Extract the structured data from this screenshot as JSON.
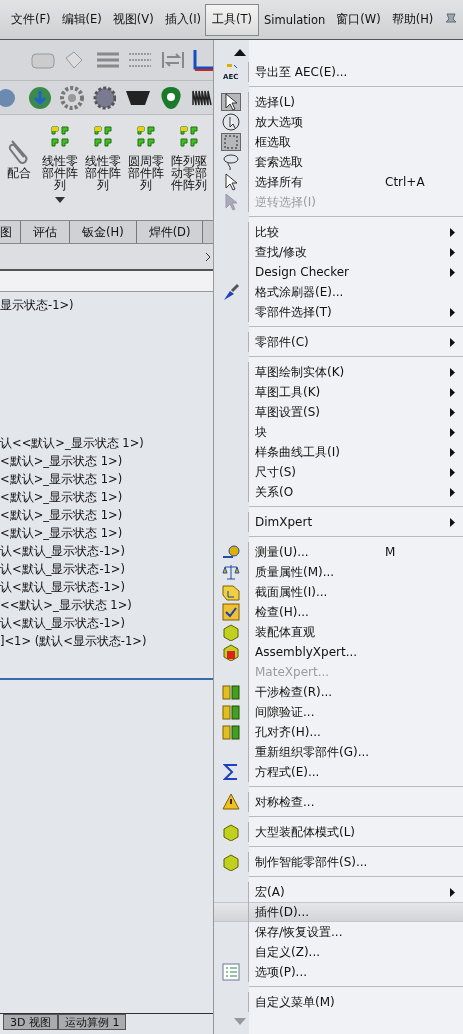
{
  "menu_bar": [
    {
      "label": "文件(F)",
      "selected": false
    },
    {
      "label": "编辑(E)",
      "selected": false
    },
    {
      "label": "视图(V)",
      "selected": false
    },
    {
      "label": "插入(I)",
      "selected": false
    },
    {
      "label": "工具(T)",
      "selected": true
    },
    {
      "label": "Simulation",
      "selected": false
    },
    {
      "label": "窗口(W)",
      "selected": false
    },
    {
      "label": "帮助(H)",
      "selected": false
    }
  ],
  "command_manager": [
    {
      "label": "配合",
      "dropdown": false
    },
    {
      "label": "线性零部件阵列",
      "dropdown": true
    },
    {
      "label": "线性零部件阵列",
      "dropdown": false
    },
    {
      "label": "圆周零部件阵列",
      "dropdown": false
    },
    {
      "label": "阵列驱动零部件阵列",
      "dropdown": false
    }
  ],
  "tabs": [
    {
      "label": "图"
    },
    {
      "label": "评估"
    },
    {
      "label": "钣金(H)"
    },
    {
      "label": "焊件(D)"
    }
  ],
  "tree": {
    "top_line": "显示状态-1>)",
    "lines": [
      "认<<默认>_显示状态 1>)",
      "<默认>_显示状态 1>)",
      "<默认>_显示状态 1>)",
      "<默认>_显示状态 1>)",
      "<默认>_显示状态 1>)",
      "<默认>_显示状态 1>)",
      "认<默认_显示状态-1>)",
      "认<默认_显示状态-1>)",
      "认<默认_显示状态-1>)",
      "<<默认>_显示状态 1>)",
      "认<默认_显示状态-1>)",
      "]<1> (默认<显示状态-1>)"
    ]
  },
  "bottom_tabs": [
    {
      "label": "3D 视图"
    },
    {
      "label": "运动算例 1"
    }
  ],
  "tools_menu": [
    {
      "kind": "item",
      "label": "导出至 AEC(E)...",
      "icon_label": "AEC",
      "submenu": false,
      "disabled": false,
      "highlighted": false,
      "pressed": false
    },
    {
      "kind": "separator"
    },
    {
      "kind": "item",
      "label": "选择(L)",
      "submenu": false,
      "disabled": false,
      "highlighted": false,
      "pressed": true
    },
    {
      "kind": "item",
      "label": "放大选项",
      "submenu": false,
      "disabled": false,
      "highlighted": false,
      "pressed": false
    },
    {
      "kind": "item",
      "label": "框选取",
      "submenu": false,
      "disabled": false,
      "highlighted": false,
      "pressed": true
    },
    {
      "kind": "item",
      "label": "套索选取",
      "submenu": false,
      "disabled": false,
      "highlighted": false,
      "pressed": false
    },
    {
      "kind": "item",
      "label": "选择所有",
      "shortcut": "Ctrl+A",
      "submenu": false,
      "disabled": false,
      "highlighted": false,
      "pressed": false
    },
    {
      "kind": "item",
      "label": "逆转选择(I)",
      "submenu": false,
      "disabled": true,
      "highlighted": false,
      "pressed": false
    },
    {
      "kind": "separator"
    },
    {
      "kind": "item",
      "label": "比较",
      "submenu": true,
      "disabled": false,
      "highlighted": false,
      "pressed": false
    },
    {
      "kind": "item",
      "label": "查找/修改",
      "submenu": true,
      "disabled": false,
      "highlighted": false,
      "pressed": false
    },
    {
      "kind": "item",
      "label": "Design Checker",
      "submenu": true,
      "disabled": false,
      "highlighted": false,
      "pressed": false
    },
    {
      "kind": "item",
      "label": "格式涂刷器(E)...",
      "submenu": false,
      "disabled": false,
      "highlighted": false,
      "pressed": false
    },
    {
      "kind": "item",
      "label": "零部件选择(T)",
      "submenu": true,
      "disabled": false,
      "highlighted": false,
      "pressed": false
    },
    {
      "kind": "separator"
    },
    {
      "kind": "item",
      "label": "零部件(C)",
      "submenu": true,
      "disabled": false,
      "highlighted": false,
      "pressed": false
    },
    {
      "kind": "separator"
    },
    {
      "kind": "item",
      "label": "草图绘制实体(K)",
      "submenu": true,
      "disabled": false,
      "highlighted": false,
      "pressed": false
    },
    {
      "kind": "item",
      "label": "草图工具(K)",
      "submenu": true,
      "disabled": false,
      "highlighted": false,
      "pressed": false
    },
    {
      "kind": "item",
      "label": "草图设置(S)",
      "submenu": true,
      "disabled": false,
      "highlighted": false,
      "pressed": false
    },
    {
      "kind": "item",
      "label": "块",
      "submenu": true,
      "disabled": false,
      "highlighted": false,
      "pressed": false
    },
    {
      "kind": "item",
      "label": "样条曲线工具(I)",
      "submenu": true,
      "disabled": false,
      "highlighted": false,
      "pressed": false
    },
    {
      "kind": "item",
      "label": "尺寸(S)",
      "submenu": true,
      "disabled": false,
      "highlighted": false,
      "pressed": false
    },
    {
      "kind": "item",
      "label": "关系(O",
      "submenu": true,
      "disabled": false,
      "highlighted": false,
      "pressed": false
    },
    {
      "kind": "separator"
    },
    {
      "kind": "item",
      "label": "DimXpert",
      "submenu": true,
      "disabled": false,
      "highlighted": false,
      "pressed": false
    },
    {
      "kind": "separator"
    },
    {
      "kind": "item",
      "label": "测量(U)...",
      "shortcut": "M",
      "submenu": false,
      "disabled": false,
      "highlighted": false,
      "pressed": false
    },
    {
      "kind": "item",
      "label": "质量属性(M)...",
      "submenu": false,
      "disabled": false,
      "highlighted": false,
      "pressed": false
    },
    {
      "kind": "item",
      "label": "截面属性(I)...",
      "submenu": false,
      "disabled": false,
      "highlighted": false,
      "pressed": false
    },
    {
      "kind": "item",
      "label": "检查(H)...",
      "submenu": false,
      "disabled": false,
      "highlighted": false,
      "pressed": false
    },
    {
      "kind": "item",
      "label": "装配体直观",
      "submenu": false,
      "disabled": false,
      "highlighted": false,
      "pressed": false
    },
    {
      "kind": "item",
      "label": "AssemblyXpert...",
      "submenu": false,
      "disabled": false,
      "highlighted": false,
      "pressed": false
    },
    {
      "kind": "item",
      "label": "MateXpert...",
      "submenu": false,
      "disabled": true,
      "highlighted": false,
      "pressed": false
    },
    {
      "kind": "item",
      "label": "干涉检查(R)...",
      "submenu": false,
      "disabled": false,
      "highlighted": false,
      "pressed": false
    },
    {
      "kind": "item",
      "label": "间隙验证...",
      "submenu": false,
      "disabled": false,
      "highlighted": false,
      "pressed": false
    },
    {
      "kind": "item",
      "label": "孔对齐(H)...",
      "submenu": false,
      "disabled": false,
      "highlighted": false,
      "pressed": false
    },
    {
      "kind": "item",
      "label": "重新组织零部件(G)...",
      "submenu": false,
      "disabled": false,
      "highlighted": false,
      "pressed": false
    },
    {
      "kind": "item",
      "label": "方程式(E)...",
      "submenu": false,
      "disabled": false,
      "highlighted": false,
      "pressed": false
    },
    {
      "kind": "separator"
    },
    {
      "kind": "item",
      "label": "对称检查...",
      "submenu": false,
      "disabled": false,
      "highlighted": false,
      "pressed": false
    },
    {
      "kind": "separator"
    },
    {
      "kind": "item",
      "label": "大型装配体模式(L)",
      "submenu": false,
      "disabled": false,
      "highlighted": false,
      "pressed": false
    },
    {
      "kind": "separator"
    },
    {
      "kind": "item",
      "label": "制作智能零部件(S)...",
      "submenu": false,
      "disabled": false,
      "highlighted": false,
      "pressed": false
    },
    {
      "kind": "separator"
    },
    {
      "kind": "item",
      "label": "宏(A)",
      "submenu": true,
      "disabled": false,
      "highlighted": false,
      "pressed": false
    },
    {
      "kind": "item",
      "label": "插件(D)...",
      "submenu": false,
      "disabled": false,
      "highlighted": true,
      "pressed": false
    },
    {
      "kind": "item",
      "label": "保存/恢复设置...",
      "submenu": false,
      "disabled": false,
      "highlighted": false,
      "pressed": false
    },
    {
      "kind": "item",
      "label": "自定义(Z)...",
      "submenu": false,
      "disabled": false,
      "highlighted": false,
      "pressed": false
    },
    {
      "kind": "item",
      "label": "选项(P)...",
      "submenu": false,
      "disabled": false,
      "highlighted": false,
      "pressed": false
    },
    {
      "kind": "separator"
    },
    {
      "kind": "item",
      "label": "自定义菜单(M)",
      "submenu": false,
      "disabled": false,
      "highlighted": false,
      "pressed": false
    }
  ]
}
